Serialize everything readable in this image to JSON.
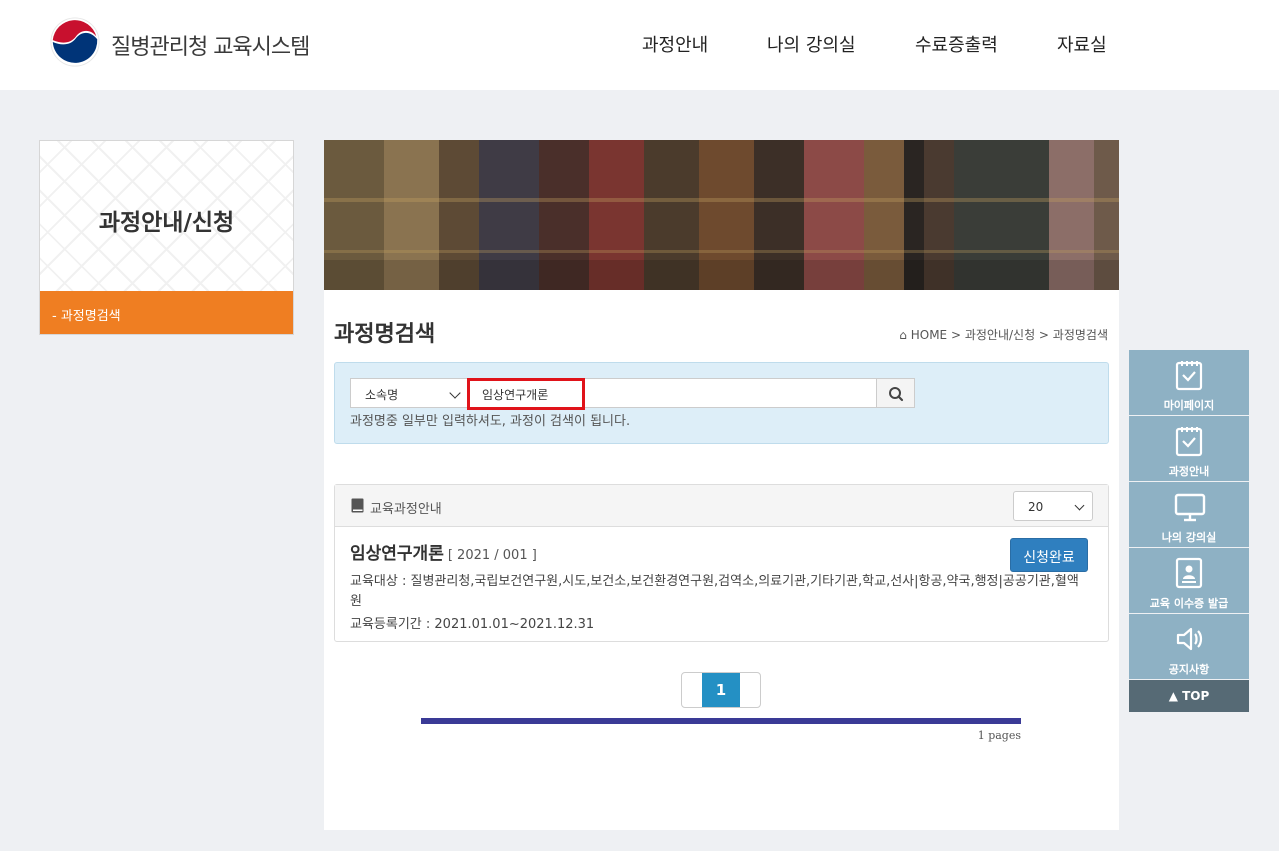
{
  "header": {
    "logo_text": "질병관리청 교육시스템",
    "nav": [
      "과정안내",
      "나의 강의실",
      "수료증출력",
      "자료실"
    ]
  },
  "sidebar": {
    "title": "과정안내/신청",
    "item": "- 과정명검색"
  },
  "main": {
    "title": "과정명검색",
    "breadcrumb": "HOME > 과정안내/신청 > 과정명검색"
  },
  "search": {
    "category": "소속명",
    "query": "임상연구개론",
    "hint": "과정명중 일부만 입력하셔도, 과정이 검색이 됩니다."
  },
  "list": {
    "header": "교육과정안내",
    "per_page": "20",
    "course": {
      "name": "임상연구개론",
      "code": "[ 2021 / 001 ]",
      "status_button": "신청완료",
      "target": "교육대상 : 질병관리청,국립보건연구원,시도,보건소,보건환경연구원,검역소,의료기관,기타기관,학교,선사|항공,약국,행정|공공기관,혈액원",
      "period": "교육등록기간 : 2021.01.01~2021.12.31"
    }
  },
  "pagination": {
    "current": "1",
    "pages_text": "1 pages"
  },
  "quick_menu": {
    "items": [
      "마이페이지",
      "과정안내",
      "나의 강의실",
      "교육 이수증 발급",
      "공지사항"
    ],
    "top": "▲ TOP"
  },
  "colors": {
    "accent_orange": "#ef7e22",
    "button_blue": "#2f7fbf",
    "pager_blue": "#2490c4",
    "progress_bar": "#3a3a96",
    "quick_menu": "#8eb1c4",
    "search_box": "#ddeef8",
    "highlight_red": "#e0131a"
  }
}
